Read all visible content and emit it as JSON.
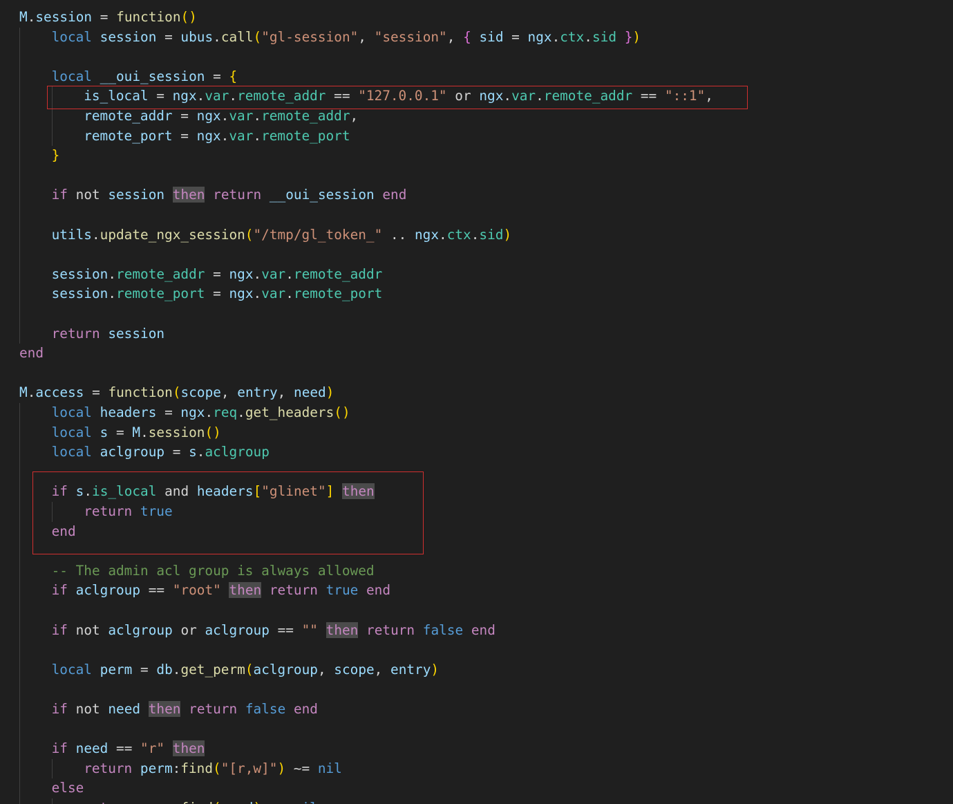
{
  "colors": {
    "background": "#1f1f1f",
    "highlight_box": "#d12f2f",
    "indent_guide": "#404040",
    "keyword_highlight": "#4b4b4b"
  },
  "code_lines": [
    [
      [
        "M",
        "var"
      ],
      [
        ".",
        "op"
      ],
      [
        "session",
        "var"
      ],
      [
        " = ",
        "op"
      ],
      [
        "function",
        "fn"
      ],
      [
        "()",
        "p1"
      ]
    ],
    [
      [
        "local",
        "dec"
      ],
      [
        " ",
        "op"
      ],
      [
        "session",
        "var"
      ],
      [
        " = ",
        "op"
      ],
      [
        "ubus",
        "var"
      ],
      [
        ".",
        "op"
      ],
      [
        "call",
        "fn"
      ],
      [
        "(",
        "p1"
      ],
      [
        "\"gl-session\"",
        "str"
      ],
      [
        ", ",
        "op"
      ],
      [
        "\"session\"",
        "str"
      ],
      [
        ", ",
        "op"
      ],
      [
        "{",
        "p2"
      ],
      [
        " ",
        "op"
      ],
      [
        "sid",
        "var"
      ],
      [
        " = ",
        "op"
      ],
      [
        "ngx",
        "var"
      ],
      [
        ".",
        "op"
      ],
      [
        "ctx",
        "fld"
      ],
      [
        ".",
        "op"
      ],
      [
        "sid",
        "fld"
      ],
      [
        " ",
        "op"
      ],
      [
        "}",
        "p2"
      ],
      [
        ")",
        "p1"
      ]
    ],
    [],
    [
      [
        "local",
        "dec"
      ],
      [
        " ",
        "op"
      ],
      [
        "__oui_session",
        "var"
      ],
      [
        " = ",
        "op"
      ],
      [
        "{",
        "p1"
      ]
    ],
    [
      [
        "is_local",
        "var"
      ],
      [
        " = ",
        "op"
      ],
      [
        "ngx",
        "var"
      ],
      [
        ".",
        "op"
      ],
      [
        "var",
        "fld"
      ],
      [
        ".",
        "op"
      ],
      [
        "remote_addr",
        "fld"
      ],
      [
        " == ",
        "op"
      ],
      [
        "\"127.0.0.1\"",
        "str"
      ],
      [
        " ",
        "op"
      ],
      [
        "or",
        "id"
      ],
      [
        " ",
        "op"
      ],
      [
        "ngx",
        "var"
      ],
      [
        ".",
        "op"
      ],
      [
        "var",
        "fld"
      ],
      [
        ".",
        "op"
      ],
      [
        "remote_addr",
        "fld"
      ],
      [
        " == ",
        "op"
      ],
      [
        "\"::1\"",
        "str"
      ],
      [
        ",",
        "op"
      ]
    ],
    [
      [
        "remote_addr",
        "var"
      ],
      [
        " = ",
        "op"
      ],
      [
        "ngx",
        "var"
      ],
      [
        ".",
        "op"
      ],
      [
        "var",
        "fld"
      ],
      [
        ".",
        "op"
      ],
      [
        "remote_addr",
        "fld"
      ],
      [
        ",",
        "op"
      ]
    ],
    [
      [
        "remote_port",
        "var"
      ],
      [
        " = ",
        "op"
      ],
      [
        "ngx",
        "var"
      ],
      [
        ".",
        "op"
      ],
      [
        "var",
        "fld"
      ],
      [
        ".",
        "op"
      ],
      [
        "remote_port",
        "fld"
      ]
    ],
    [
      [
        "}",
        "p1"
      ]
    ],
    [],
    [
      [
        "if",
        "kw"
      ],
      [
        " ",
        "op"
      ],
      [
        "not",
        "id"
      ],
      [
        " ",
        "op"
      ],
      [
        "session",
        "var"
      ],
      [
        " ",
        "op"
      ],
      [
        "then",
        "kw",
        "hl"
      ],
      [
        " ",
        "op"
      ],
      [
        "return",
        "kw"
      ],
      [
        " ",
        "op"
      ],
      [
        "__oui_session",
        "var"
      ],
      [
        " ",
        "op"
      ],
      [
        "end",
        "kw"
      ]
    ],
    [],
    [
      [
        "utils",
        "var"
      ],
      [
        ".",
        "op"
      ],
      [
        "update_ngx_session",
        "fn"
      ],
      [
        "(",
        "p1"
      ],
      [
        "\"/tmp/gl_token_\"",
        "str"
      ],
      [
        " .. ",
        "op"
      ],
      [
        "ngx",
        "var"
      ],
      [
        ".",
        "op"
      ],
      [
        "ctx",
        "fld"
      ],
      [
        ".",
        "op"
      ],
      [
        "sid",
        "fld"
      ],
      [
        ")",
        "p1"
      ]
    ],
    [],
    [
      [
        "session",
        "var"
      ],
      [
        ".",
        "op"
      ],
      [
        "remote_addr",
        "fld"
      ],
      [
        " = ",
        "op"
      ],
      [
        "ngx",
        "var"
      ],
      [
        ".",
        "op"
      ],
      [
        "var",
        "fld"
      ],
      [
        ".",
        "op"
      ],
      [
        "remote_addr",
        "fld"
      ]
    ],
    [
      [
        "session",
        "var"
      ],
      [
        ".",
        "op"
      ],
      [
        "remote_port",
        "fld"
      ],
      [
        " = ",
        "op"
      ],
      [
        "ngx",
        "var"
      ],
      [
        ".",
        "op"
      ],
      [
        "var",
        "fld"
      ],
      [
        ".",
        "op"
      ],
      [
        "remote_port",
        "fld"
      ]
    ],
    [],
    [
      [
        "return",
        "kw"
      ],
      [
        " ",
        "op"
      ],
      [
        "session",
        "var"
      ]
    ],
    [
      [
        "end",
        "kw"
      ]
    ],
    [],
    [
      [
        "M",
        "var"
      ],
      [
        ".",
        "op"
      ],
      [
        "access",
        "var"
      ],
      [
        " = ",
        "op"
      ],
      [
        "function",
        "fn"
      ],
      [
        "(",
        "p1"
      ],
      [
        "scope",
        "var"
      ],
      [
        ", ",
        "op"
      ],
      [
        "entry",
        "var"
      ],
      [
        ", ",
        "op"
      ],
      [
        "need",
        "var"
      ],
      [
        ")",
        "p1"
      ]
    ],
    [
      [
        "local",
        "dec"
      ],
      [
        " ",
        "op"
      ],
      [
        "headers",
        "var"
      ],
      [
        " = ",
        "op"
      ],
      [
        "ngx",
        "var"
      ],
      [
        ".",
        "op"
      ],
      [
        "req",
        "fld"
      ],
      [
        ".",
        "op"
      ],
      [
        "get_headers",
        "fn"
      ],
      [
        "()",
        "p1"
      ]
    ],
    [
      [
        "local",
        "dec"
      ],
      [
        " ",
        "op"
      ],
      [
        "s",
        "var"
      ],
      [
        " = ",
        "op"
      ],
      [
        "M",
        "var"
      ],
      [
        ".",
        "op"
      ],
      [
        "session",
        "fn"
      ],
      [
        "()",
        "p1"
      ]
    ],
    [
      [
        "local",
        "dec"
      ],
      [
        " ",
        "op"
      ],
      [
        "aclgroup",
        "var"
      ],
      [
        " = ",
        "op"
      ],
      [
        "s",
        "var"
      ],
      [
        ".",
        "op"
      ],
      [
        "aclgroup",
        "fld"
      ]
    ],
    [],
    [
      [
        "if",
        "kw"
      ],
      [
        " ",
        "op"
      ],
      [
        "s",
        "var"
      ],
      [
        ".",
        "op"
      ],
      [
        "is_local",
        "fld"
      ],
      [
        " ",
        "op"
      ],
      [
        "and",
        "id"
      ],
      [
        " ",
        "op"
      ],
      [
        "headers",
        "var"
      ],
      [
        "[",
        "p1"
      ],
      [
        "\"glinet\"",
        "str"
      ],
      [
        "]",
        "p1"
      ],
      [
        " ",
        "op"
      ],
      [
        "then",
        "kw",
        "hl"
      ]
    ],
    [
      [
        "return",
        "kw"
      ],
      [
        " ",
        "op"
      ],
      [
        "true",
        "dec"
      ]
    ],
    [
      [
        "end",
        "kw"
      ]
    ],
    [],
    [
      [
        "-- The admin acl group is always allowed",
        "cm"
      ]
    ],
    [
      [
        "if",
        "kw"
      ],
      [
        " ",
        "op"
      ],
      [
        "aclgroup",
        "var"
      ],
      [
        " == ",
        "op"
      ],
      [
        "\"root\"",
        "str"
      ],
      [
        " ",
        "op"
      ],
      [
        "then",
        "kw",
        "hl"
      ],
      [
        " ",
        "op"
      ],
      [
        "return",
        "kw"
      ],
      [
        " ",
        "op"
      ],
      [
        "true",
        "dec"
      ],
      [
        " ",
        "op"
      ],
      [
        "end",
        "kw"
      ]
    ],
    [],
    [
      [
        "if",
        "kw"
      ],
      [
        " ",
        "op"
      ],
      [
        "not",
        "id"
      ],
      [
        " ",
        "op"
      ],
      [
        "aclgroup",
        "var"
      ],
      [
        " ",
        "op"
      ],
      [
        "or",
        "id"
      ],
      [
        " ",
        "op"
      ],
      [
        "aclgroup",
        "var"
      ],
      [
        " == ",
        "op"
      ],
      [
        "\"\"",
        "str"
      ],
      [
        " ",
        "op"
      ],
      [
        "then",
        "kw",
        "hl"
      ],
      [
        " ",
        "op"
      ],
      [
        "return",
        "kw"
      ],
      [
        " ",
        "op"
      ],
      [
        "false",
        "dec"
      ],
      [
        " ",
        "op"
      ],
      [
        "end",
        "kw"
      ]
    ],
    [],
    [
      [
        "local",
        "dec"
      ],
      [
        " ",
        "op"
      ],
      [
        "perm",
        "var"
      ],
      [
        " = ",
        "op"
      ],
      [
        "db",
        "var"
      ],
      [
        ".",
        "op"
      ],
      [
        "get_perm",
        "fn"
      ],
      [
        "(",
        "p1"
      ],
      [
        "aclgroup",
        "var"
      ],
      [
        ", ",
        "op"
      ],
      [
        "scope",
        "var"
      ],
      [
        ", ",
        "op"
      ],
      [
        "entry",
        "var"
      ],
      [
        ")",
        "p1"
      ]
    ],
    [],
    [
      [
        "if",
        "kw"
      ],
      [
        " ",
        "op"
      ],
      [
        "not",
        "id"
      ],
      [
        " ",
        "op"
      ],
      [
        "need",
        "var"
      ],
      [
        " ",
        "op"
      ],
      [
        "then",
        "kw",
        "hl"
      ],
      [
        " ",
        "op"
      ],
      [
        "return",
        "kw"
      ],
      [
        " ",
        "op"
      ],
      [
        "false",
        "dec"
      ],
      [
        " ",
        "op"
      ],
      [
        "end",
        "kw"
      ]
    ],
    [],
    [
      [
        "if",
        "kw"
      ],
      [
        " ",
        "op"
      ],
      [
        "need",
        "var"
      ],
      [
        " == ",
        "op"
      ],
      [
        "\"r\"",
        "str"
      ],
      [
        " ",
        "op"
      ],
      [
        "then",
        "kw",
        "hl"
      ]
    ],
    [
      [
        "return",
        "kw"
      ],
      [
        " ",
        "op"
      ],
      [
        "perm",
        "var"
      ],
      [
        ":",
        "op"
      ],
      [
        "find",
        "fn"
      ],
      [
        "(",
        "p1"
      ],
      [
        "\"[r,w]\"",
        "str"
      ],
      [
        ")",
        "p1"
      ],
      [
        " ~= ",
        "op"
      ],
      [
        "nil",
        "dec"
      ]
    ],
    [
      [
        "else",
        "kw"
      ]
    ],
    [
      [
        "return",
        "kw"
      ],
      [
        " ",
        "op"
      ],
      [
        "perm",
        "var"
      ],
      [
        ":",
        "op"
      ],
      [
        "find",
        "fn"
      ],
      [
        "(",
        "p1"
      ],
      [
        "need",
        "var"
      ],
      [
        ")",
        "p1"
      ],
      [
        " ~= ",
        "op"
      ],
      [
        "nil",
        "dec"
      ]
    ]
  ]
}
